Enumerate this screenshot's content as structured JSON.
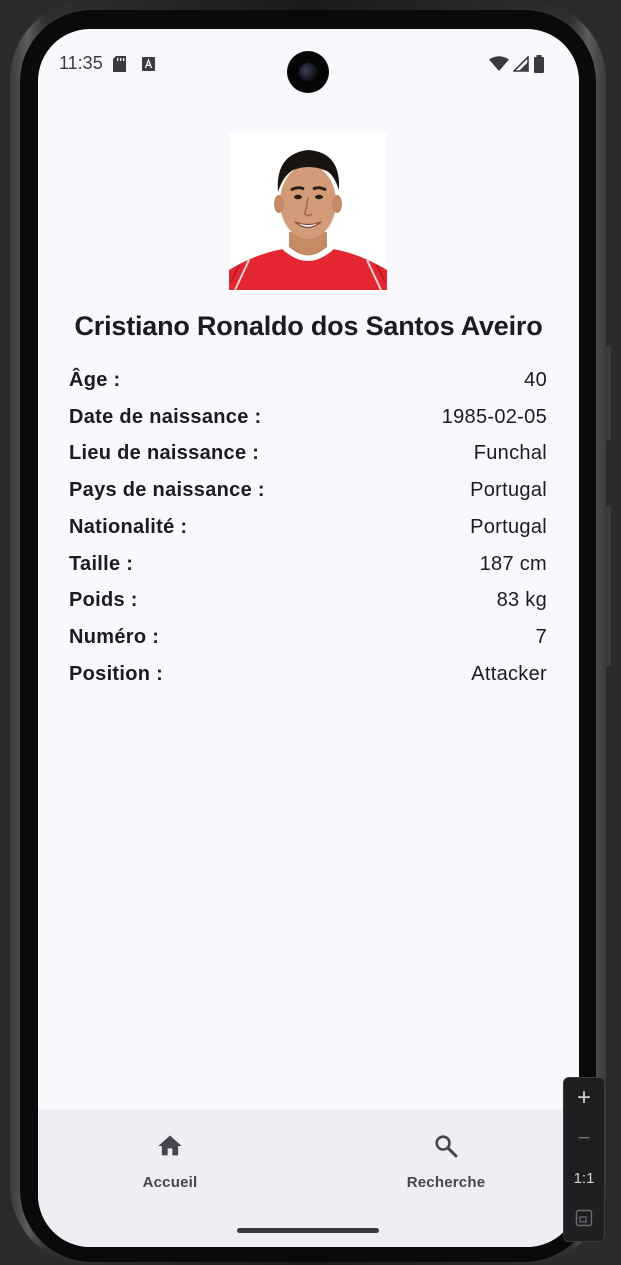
{
  "status_bar": {
    "time": "11:35",
    "left_icons": [
      "sd-card-icon",
      "text-a-icon"
    ],
    "right_icons": [
      "wifi-icon",
      "signal-icon",
      "battery-icon"
    ]
  },
  "player": {
    "name": "Cristiano Ronaldo dos Santos Aveiro",
    "photo_alt": "player-photo"
  },
  "details": [
    {
      "label": "Âge :",
      "value": "40"
    },
    {
      "label": "Date de naissance :",
      "value": "1985-02-05"
    },
    {
      "label": "Lieu de naissance :",
      "value": "Funchal"
    },
    {
      "label": "Pays de naissance :",
      "value": "Portugal"
    },
    {
      "label": "Nationalité :",
      "value": "Portugal"
    },
    {
      "label": "Taille :",
      "value": "187 cm"
    },
    {
      "label": "Poids :",
      "value": "83 kg"
    },
    {
      "label": "Numéro :",
      "value": "7"
    },
    {
      "label": "Position :",
      "value": "Attacker"
    }
  ],
  "bottom_nav": {
    "home_label": "Accueil",
    "home_icon": "home-icon",
    "search_label": "Recherche",
    "search_icon": "search-icon"
  },
  "emulator_toolbar": {
    "zoom_in": "+",
    "zoom_out": "−",
    "actual_size": "1:1",
    "fit_icon": "fit-screen-icon"
  },
  "colors": {
    "screen_background": "#f8f8fd",
    "nav_background": "#eeeef4",
    "text_primary": "#1c1b20",
    "nav_text": "#45464f",
    "jersey_red": "#e3262f"
  }
}
